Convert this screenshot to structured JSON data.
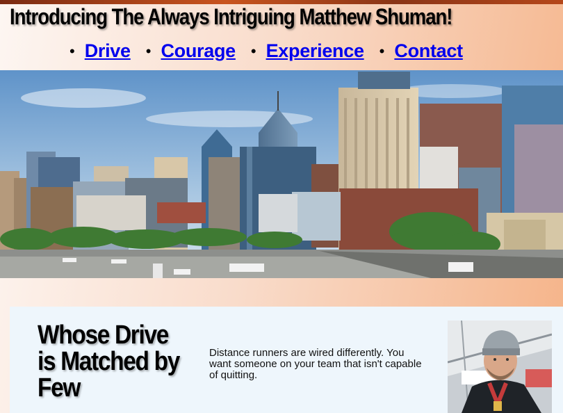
{
  "header": {
    "title": "Introducing The Always Intriguing Matthew Shuman!"
  },
  "nav": {
    "items": [
      {
        "label": "Drive"
      },
      {
        "label": "Courage"
      },
      {
        "label": "Experience"
      },
      {
        "label": "Contact"
      }
    ]
  },
  "hero": {
    "description": "city skyline photo"
  },
  "feature": {
    "heading": "Whose Drive is Matched by Few",
    "body": "Distance runners are wired differently. You want someone on your team that isn't capable of quitting."
  },
  "colors": {
    "link": "#0000ee",
    "card_background": "#eef6fc",
    "gradient_start": "#fdf6f2",
    "gradient_end": "#f5b388"
  }
}
